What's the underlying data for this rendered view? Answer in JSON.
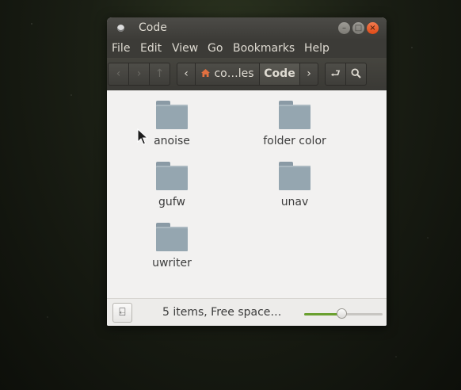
{
  "window": {
    "title": "Code",
    "controls": {
      "minimize": "–",
      "maximize": "□",
      "close": "×"
    }
  },
  "menu": [
    "File",
    "Edit",
    "View",
    "Go",
    "Bookmarks",
    "Help"
  ],
  "toolbar": {
    "back_icon": "‹",
    "forward_icon": "›",
    "up_icon": "↑",
    "crumb_left_icon": "‹",
    "crumb_right_icon": "›",
    "home_crumb_label": "co…les",
    "current_crumb_label": "Code",
    "toggle_location_icon": "⮐",
    "search_icon": "⌕"
  },
  "items": [
    {
      "label": "anoise"
    },
    {
      "label": "folder color"
    },
    {
      "label": "gufw"
    },
    {
      "label": "unav"
    },
    {
      "label": "uwriter"
    }
  ],
  "status": {
    "text": "5 items, Free space…",
    "pane_icon": "⍇",
    "zoom_level": 0.47
  },
  "colors": {
    "folder": "#95a6b0",
    "accent": "#6aa030",
    "close_button": "#df4a16"
  }
}
